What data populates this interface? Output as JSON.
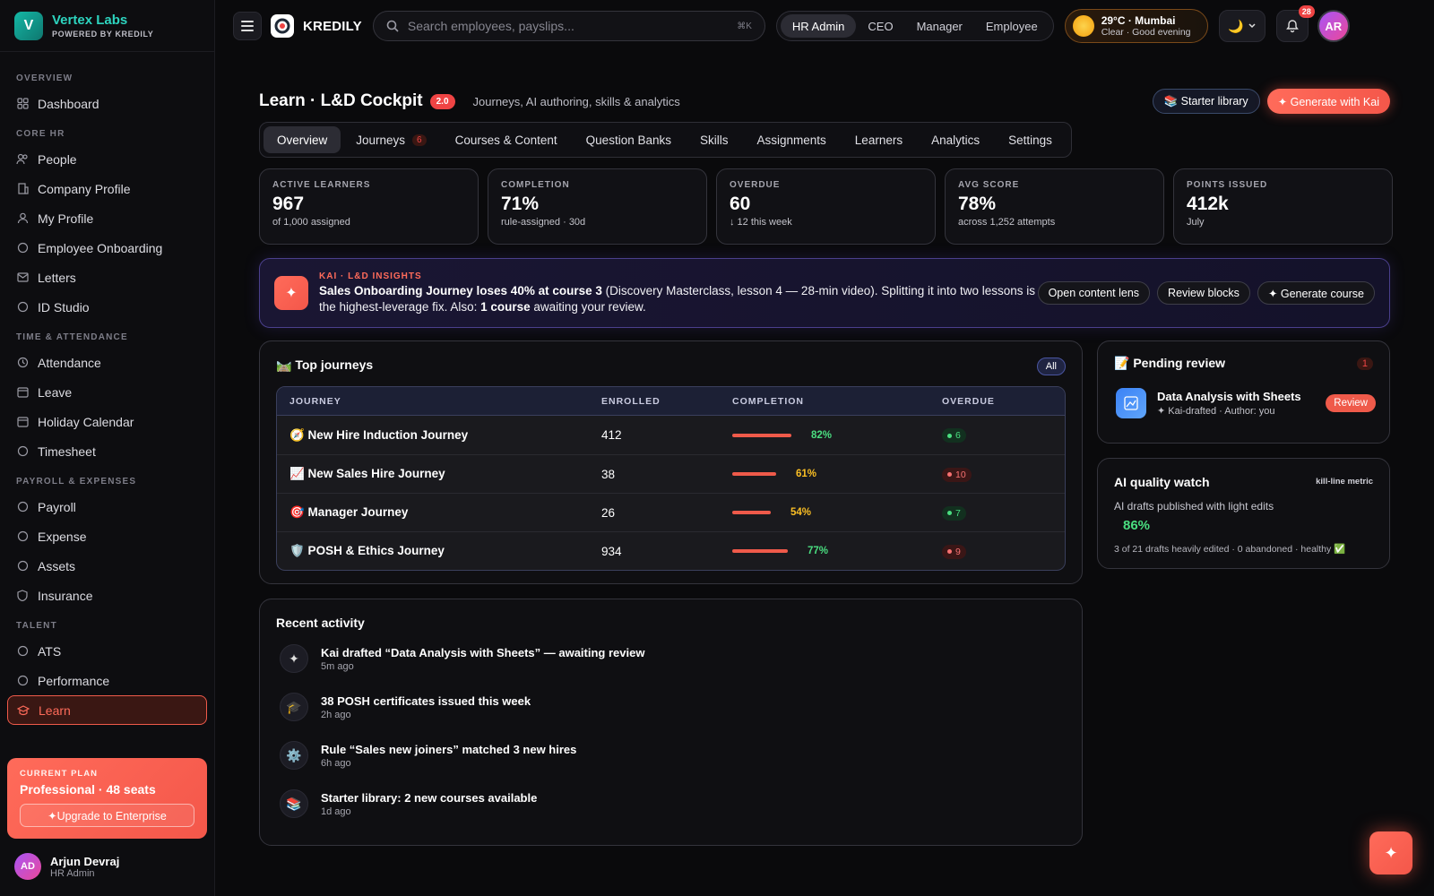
{
  "brand": {
    "name": "Vertex Labs",
    "sub": "POWERED BY KREDILY",
    "logo_letter": "V"
  },
  "sidebar": {
    "sections": [
      {
        "title": "OVERVIEW",
        "items": [
          {
            "label": "Dashboard",
            "icon": "grid-icon"
          }
        ]
      },
      {
        "title": "CORE HR",
        "items": [
          {
            "label": "People",
            "icon": "people-icon"
          },
          {
            "label": "Company Profile",
            "icon": "building-icon"
          },
          {
            "label": "My Profile",
            "icon": "user-icon"
          },
          {
            "label": "Employee Onboarding",
            "icon": "user-plus-icon"
          },
          {
            "label": "Letters",
            "icon": "mail-icon"
          },
          {
            "label": "ID Studio",
            "icon": "id-card-icon"
          }
        ]
      },
      {
        "title": "TIME & ATTENDANCE",
        "items": [
          {
            "label": "Attendance",
            "icon": "clock-icon"
          },
          {
            "label": "Leave",
            "icon": "calendar-icon"
          },
          {
            "label": "Holiday Calendar",
            "icon": "calendar-icon"
          },
          {
            "label": "Timesheet",
            "icon": "timer-icon"
          }
        ]
      },
      {
        "title": "PAYROLL & EXPENSES",
        "items": [
          {
            "label": "Payroll",
            "icon": "coin-icon"
          },
          {
            "label": "Expense",
            "icon": "receipt-icon"
          },
          {
            "label": "Assets",
            "icon": "monitor-icon"
          },
          {
            "label": "Insurance",
            "icon": "shield-icon"
          }
        ]
      },
      {
        "title": "TALENT",
        "items": [
          {
            "label": "ATS",
            "icon": "clipboard-icon"
          },
          {
            "label": "Performance",
            "icon": "trophy-icon"
          },
          {
            "label": "Learn",
            "icon": "graduation-cap-icon",
            "active": true
          }
        ]
      }
    ]
  },
  "plan": {
    "label": "CURRENT PLAN",
    "name": "Professional · 48 seats",
    "upgrade": "✦Upgrade to Enterprise"
  },
  "user": {
    "initials": "AD",
    "name": "Arjun Devraj",
    "role": "HR Admin"
  },
  "topbar": {
    "product": "KREDILY",
    "search_placeholder": "Search employees, payslips...",
    "search_shortcut": "⌘K",
    "roles": [
      {
        "label": "HR Admin",
        "active": true
      },
      {
        "label": "CEO"
      },
      {
        "label": "Manager"
      },
      {
        "label": "Employee"
      }
    ],
    "weather_main": "29°C · Mumbai",
    "weather_sub": "Clear · Good evening",
    "theme_icon": "🌙",
    "notifications": "28",
    "avatar": "AR"
  },
  "page": {
    "title": "Learn · L&D Cockpit",
    "version": "2.0",
    "subtitle": "Journeys, AI authoring, skills & analytics",
    "starter_btn": "📚 Starter library",
    "generate_btn": "✦ Generate with Kai",
    "tabs": [
      {
        "label": "Overview",
        "active": true
      },
      {
        "label": "Journeys",
        "count": "6"
      },
      {
        "label": "Courses & Content"
      },
      {
        "label": "Question Banks"
      },
      {
        "label": "Skills"
      },
      {
        "label": "Assignments"
      },
      {
        "label": "Learners"
      },
      {
        "label": "Analytics"
      },
      {
        "label": "Settings"
      }
    ]
  },
  "stats": [
    {
      "label": "ACTIVE LEARNERS",
      "value": "967",
      "sub": "of 1,000 assigned"
    },
    {
      "label": "COMPLETION",
      "value": "71%",
      "sub": "rule-assigned · 30d"
    },
    {
      "label": "OVERDUE",
      "value": "60",
      "sub": "↓ 12 this week"
    },
    {
      "label": "AVG SCORE",
      "value": "78%",
      "sub": "across 1,252 attempts"
    },
    {
      "label": "POINTS ISSUED",
      "value": "412k",
      "sub": "July"
    }
  ],
  "insight": {
    "label": "KAI · L&D INSIGHTS",
    "bold1": "Sales Onboarding Journey loses 40% at course 3",
    "text1": " (Discovery Masterclass, lesson 4 — 28-min video). Splitting it into two lessons is the highest-leverage fix. Also: ",
    "bold2": "1 course",
    "text2": " awaiting your review.",
    "actions": [
      "Open content lens",
      "Review blocks",
      "✦ Generate course"
    ]
  },
  "journeys": {
    "title": "🛤️ Top journeys",
    "filter": "All",
    "columns": [
      "JOURNEY",
      "ENROLLED",
      "COMPLETION",
      "OVERDUE"
    ],
    "rows": [
      {
        "name": "🧭 New Hire Induction Journey",
        "enrolled": "412",
        "completion": "82%",
        "completion_value": 0.82,
        "pct_color": "#4ade80",
        "overdue": "6",
        "overdue_tone": "g"
      },
      {
        "name": "📈 New Sales Hire Journey",
        "enrolled": "38",
        "completion": "61%",
        "completion_value": 0.61,
        "pct_color": "#fbbf24",
        "overdue": "10",
        "overdue_tone": "r"
      },
      {
        "name": "🎯 Manager Journey",
        "enrolled": "26",
        "completion": "54%",
        "completion_value": 0.54,
        "pct_color": "#fbbf24",
        "overdue": "7",
        "overdue_tone": "g"
      },
      {
        "name": "🛡️ POSH & Ethics Journey",
        "enrolled": "934",
        "completion": "77%",
        "completion_value": 0.77,
        "pct_color": "#4ade80",
        "overdue": "9",
        "overdue_tone": "r"
      }
    ]
  },
  "pending": {
    "title": "📝 Pending review",
    "count": "1",
    "item_title": "Data Analysis with Sheets",
    "item_sub": "✦ Kai-drafted · Author: you",
    "review": "Review"
  },
  "quality": {
    "title": "AI quality watch",
    "tag": "kill-line metric",
    "text": "AI drafts published with light edits",
    "value": "86%",
    "sub": "3 of 21 drafts heavily edited · 0 abandoned · healthy ✅"
  },
  "activity": {
    "title": "Recent activity",
    "items": [
      {
        "icon": "✦",
        "title": "Kai drafted “Data Analysis with Sheets” — awaiting review",
        "time": "5m ago"
      },
      {
        "icon": "🎓",
        "title": "38 POSH certificates issued this week",
        "time": "2h ago"
      },
      {
        "icon": "⚙️",
        "title": "Rule “Sales new joiners” matched 3 new hires",
        "time": "6h ago"
      },
      {
        "icon": "📚",
        "title": "Starter library: 2 new courses available",
        "time": "1d ago"
      }
    ]
  },
  "fab": "✦"
}
